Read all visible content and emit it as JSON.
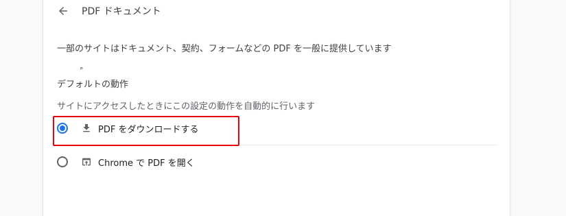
{
  "header": {
    "back_icon": "arrow-back-icon",
    "title": "PDF ドキュメント"
  },
  "description": "一部のサイトはドキュメント、契約、フォームなどの PDF を一般に提供しています",
  "stray_mark": "°",
  "default_behavior": {
    "title": "デフォルトの動作",
    "subtitle": "サイトにアクセスしたときにこの設定の動作を自動的に行います",
    "options": [
      {
        "label": "PDF をダウンロードする",
        "icon": "download-icon",
        "selected": true
      },
      {
        "label": "Chrome で PDF を開く",
        "icon": "open-in-browser-icon",
        "selected": false
      }
    ]
  },
  "colors": {
    "accent": "#1a73e8",
    "highlight": "#e8000b"
  }
}
